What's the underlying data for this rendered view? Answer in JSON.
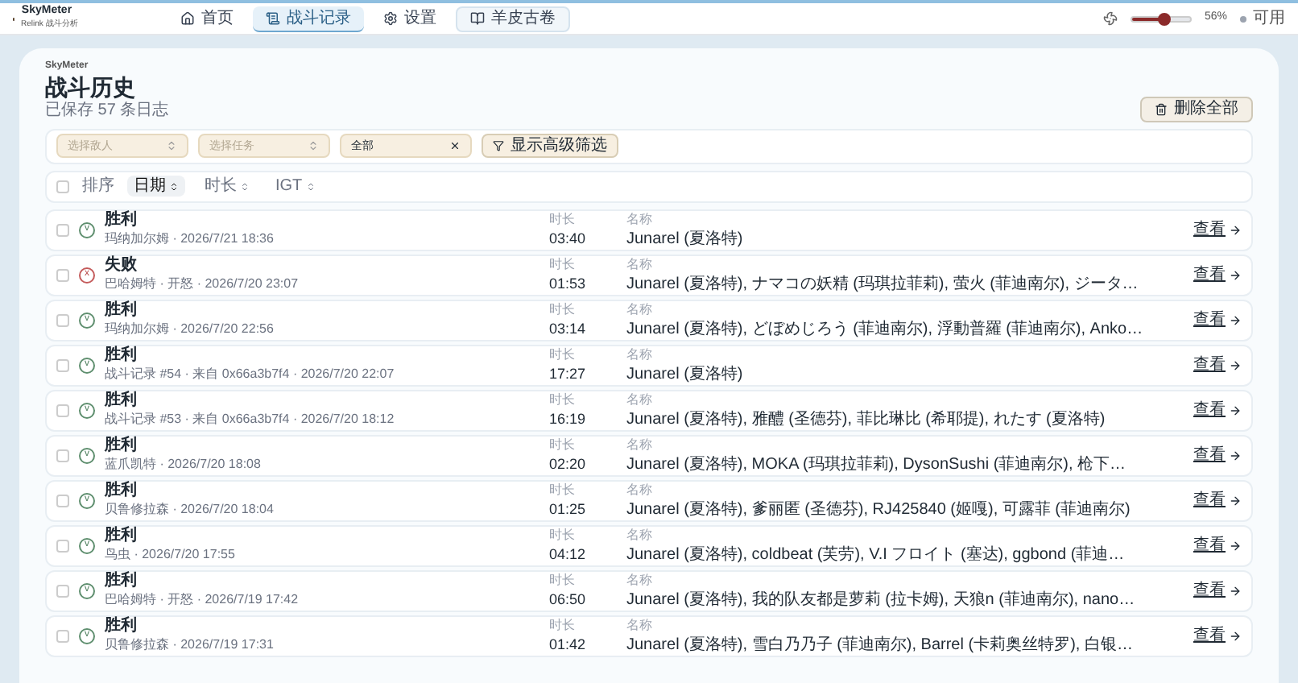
{
  "app": {
    "name": "SkyMeter",
    "subtitle": "Relink 战斗分析"
  },
  "nav": [
    {
      "label": "首页",
      "selected": false
    },
    {
      "label": "战斗记录",
      "selected": true
    },
    {
      "label": "设置",
      "selected": false
    },
    {
      "label": "羊皮古卷",
      "selected": false
    }
  ],
  "opacity": {
    "level": 0.56,
    "reading": "56%"
  },
  "status": {
    "label": "可用"
  },
  "page": {
    "eyebrow": "SkyMeter",
    "title": "战斗历史",
    "count": "已保存 57 条日志",
    "delete_all": "删除全部"
  },
  "filters": {
    "enemy": {
      "placeholder": "选择敌人"
    },
    "quest": {
      "placeholder": "选择任务"
    },
    "result": {
      "value": "全部"
    },
    "advanced": "显示高级筛选"
  },
  "sort": {
    "select_all_checked": false,
    "label": "排序",
    "options": [
      {
        "label": "日期",
        "selected": true
      },
      {
        "label": "时长",
        "selected": false
      },
      {
        "label": "IGT",
        "selected": false
      }
    ]
  },
  "logs": [
    {
      "kind": "win",
      "checked": false,
      "mark": "v",
      "title": "胜利",
      "sub": "玛纳加尔姆 · 2026/7/21 18:36",
      "duration_label": "时长",
      "duration": "03:40",
      "names_label": "名称",
      "names": "Junarel (夏洛特)",
      "view": "查看"
    },
    {
      "kind": "loss",
      "checked": false,
      "mark": "x",
      "title": "失败",
      "sub": "巴哈姆特 · 开怒 · 2026/7/20 23:07",
      "duration_label": "时长",
      "duration": "01:53",
      "names_label": "名称",
      "names": "Junarel (夏洛特), ナマコの妖精 (玛琪拉菲莉), 萤火 (菲迪南尔), ジータ…",
      "view": "查看"
    },
    {
      "kind": "win",
      "checked": false,
      "mark": "v",
      "title": "胜利",
      "sub": "玛纳加尔姆 · 2026/7/20 22:56",
      "duration_label": "时长",
      "duration": "03:14",
      "names_label": "名称",
      "names": "Junarel (夏洛特), どぼめじろう (菲迪南尔), 浮動普羅 (菲迪南尔), Anko…",
      "view": "查看"
    },
    {
      "kind": "win",
      "checked": false,
      "mark": "v",
      "title": "胜利",
      "sub": "战斗记录 #54 · 来自 0x66a3b7f4 · 2026/7/20 22:07",
      "duration_label": "时长",
      "duration": "17:27",
      "names_label": "名称",
      "names": "Junarel (夏洛特)",
      "view": "查看"
    },
    {
      "kind": "win",
      "checked": false,
      "mark": "v",
      "title": "胜利",
      "sub": "战斗记录 #53 · 来自 0x66a3b7f4 · 2026/7/20 18:12",
      "duration_label": "时长",
      "duration": "16:19",
      "names_label": "名称",
      "names": "Junarel (夏洛特), 雅醴 (圣德芬), 菲比琳比 (希耶提), れたす (夏洛特)",
      "view": "查看"
    },
    {
      "kind": "win",
      "checked": false,
      "mark": "v",
      "title": "胜利",
      "sub": "蓝爪凯特 · 2026/7/20 18:08",
      "duration_label": "时长",
      "duration": "02:20",
      "names_label": "名称",
      "names": "Junarel (夏洛特), MOKA (玛琪拉菲莉), DysonSushi (菲迪南尔), 枪下…",
      "view": "查看"
    },
    {
      "kind": "win",
      "checked": false,
      "mark": "v",
      "title": "胜利",
      "sub": "贝鲁修拉森 · 2026/7/20 18:04",
      "duration_label": "时长",
      "duration": "01:25",
      "names_label": "名称",
      "names": "Junarel (夏洛特), 爹丽匿 (圣德芬), RJ425840 (姬嘎), 可露菲 (菲迪南尔)",
      "view": "查看"
    },
    {
      "kind": "win",
      "checked": false,
      "mark": "v",
      "title": "胜利",
      "sub": "鸟虫 · 2026/7/20 17:55",
      "duration_label": "时长",
      "duration": "04:12",
      "names_label": "名称",
      "names": "Junarel (夏洛特), coldbeat (芙劳), V.I フロイト (塞达), ggbond (菲迪…",
      "view": "查看"
    },
    {
      "kind": "win",
      "checked": false,
      "mark": "v",
      "title": "胜利",
      "sub": "巴哈姆特 · 开怒 · 2026/7/19 17:42",
      "duration_label": "时长",
      "duration": "06:50",
      "names_label": "名称",
      "names": "Junarel (夏洛特), 我的队友都是萝莉 (拉卡姆), 天狼n (菲迪南尔), nano…",
      "view": "查看"
    },
    {
      "kind": "win",
      "checked": false,
      "mark": "v",
      "title": "胜利",
      "sub": "贝鲁修拉森 · 2026/7/19 17:31",
      "duration_label": "时长",
      "duration": "01:42",
      "names_label": "名称",
      "names": "Junarel (夏洛特), 雪白乃乃子 (菲迪南尔), Barrel (卡莉奥丝特罗), 白银…",
      "view": "查看"
    }
  ]
}
